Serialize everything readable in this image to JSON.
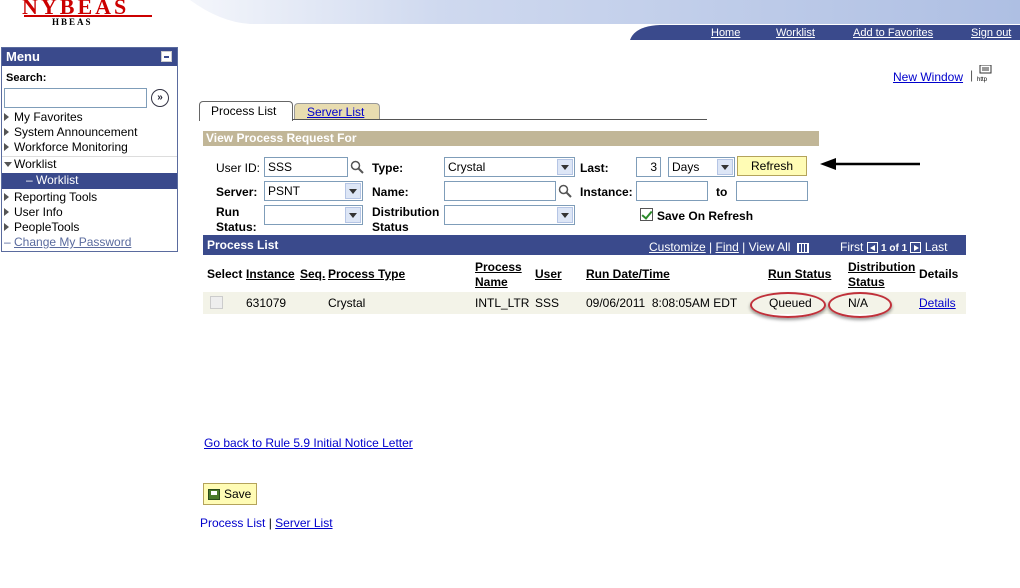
{
  "header": {
    "logo_main": "NYBEAS",
    "logo_sub": "HBEAS",
    "links": [
      "Home",
      "Worklist",
      "Add to Favorites",
      "Sign out"
    ]
  },
  "menu": {
    "title": "Menu",
    "search_label": "Search:",
    "search_value": "",
    "items": [
      "My Favorites",
      "System Announcement",
      "Workforce Monitoring",
      "Worklist",
      "Worklist",
      "Reporting Tools",
      "User Info",
      "PeopleTools",
      "Change My Password"
    ]
  },
  "top": {
    "new_window": "New Window",
    "http_icon_text": "http"
  },
  "tabs": {
    "process_list": "Process List",
    "server_list": "Server List"
  },
  "request": {
    "section_title": "View Process Request For",
    "user_id_label": "User ID:",
    "user_id_value": "SSS",
    "type_label": "Type:",
    "type_value": "Crystal",
    "last_label": "Last:",
    "last_value": "3",
    "last_unit": "Days",
    "refresh_label": "Refresh",
    "server_label": "Server:",
    "server_value": "PSNT",
    "name_label": "Name:",
    "name_value": "",
    "instance_label": "Instance:",
    "instance_from": "",
    "to_label": "to",
    "instance_to": "",
    "run_status_label_1": "Run",
    "run_status_label_2": "Status:",
    "run_status_value": "",
    "dist_status_label_1": "Distribution",
    "dist_status_label_2": "Status",
    "dist_status_value": "",
    "save_on_refresh_label": "Save On Refresh",
    "save_on_refresh_checked": true
  },
  "process_list": {
    "title": "Process List",
    "customize": "Customize",
    "find": "Find",
    "view_all": "View All",
    "first": "First",
    "counter": "1 of 1",
    "last": "Last",
    "columns": {
      "select": "Select",
      "instance": "Instance",
      "seq": "Seq.",
      "process_type": "Process Type",
      "process_name_1": "Process",
      "process_name_2": "Name",
      "user": "User",
      "run_datetime": "Run Date/Time",
      "run_status": "Run Status",
      "dist_status_1": "Distribution",
      "dist_status_2": "Status",
      "details": "Details"
    },
    "rows": [
      {
        "instance": "631079",
        "seq": "",
        "process_type": "Crystal",
        "process_name": "INTL_LTR",
        "user": "SSS",
        "run_datetime": "09/06/2011  8:08:05AM EDT",
        "run_status": "Queued",
        "dist_status": "N/A",
        "details": "Details"
      }
    ]
  },
  "footer": {
    "go_back": "Go back to Rule 5.9 Initial Notice Letter",
    "save": "Save",
    "process_list_link": "Process List",
    "separator": "|",
    "server_list_link": "Server List"
  },
  "colors": {
    "nav_blue": "#3a4a8c",
    "link_blue": "#0000cc",
    "section_tan": "#c1b697",
    "button_yellow": "#fffcb5",
    "highlight_red": "#c0303a"
  }
}
